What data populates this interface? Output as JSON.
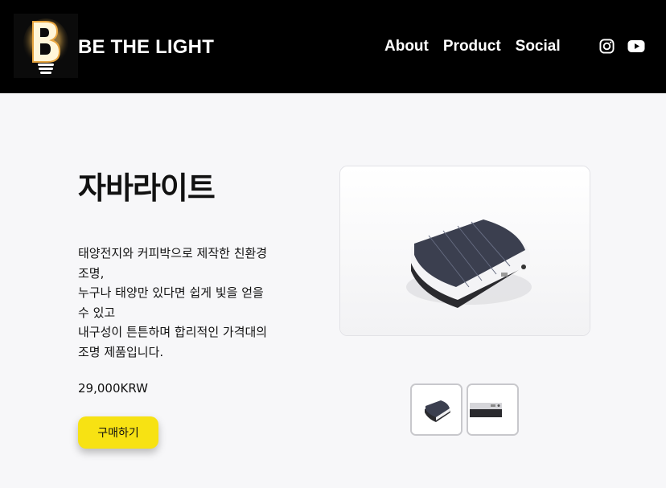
{
  "header": {
    "brand": "BE THE LIGHT",
    "nav": [
      "About",
      "Product",
      "Social"
    ],
    "social_icons": [
      "instagram-icon",
      "youtube-icon"
    ]
  },
  "product": {
    "title": "자바라이트",
    "description_lines": [
      "태양전지와 커피박으로 제작한 친환경 조명,",
      "누구나 태양만 있다면 쉽게 빛을 얻을 수 있고",
      "내구성이 튼튼하며 합리적인 가격대의 조명 제품입니다."
    ],
    "price": "29,000KRW",
    "buy_label": "구매하기"
  },
  "colors": {
    "header_bg": "#000000",
    "accent": "#f7e213",
    "page_bg": "#f7f7f9"
  }
}
